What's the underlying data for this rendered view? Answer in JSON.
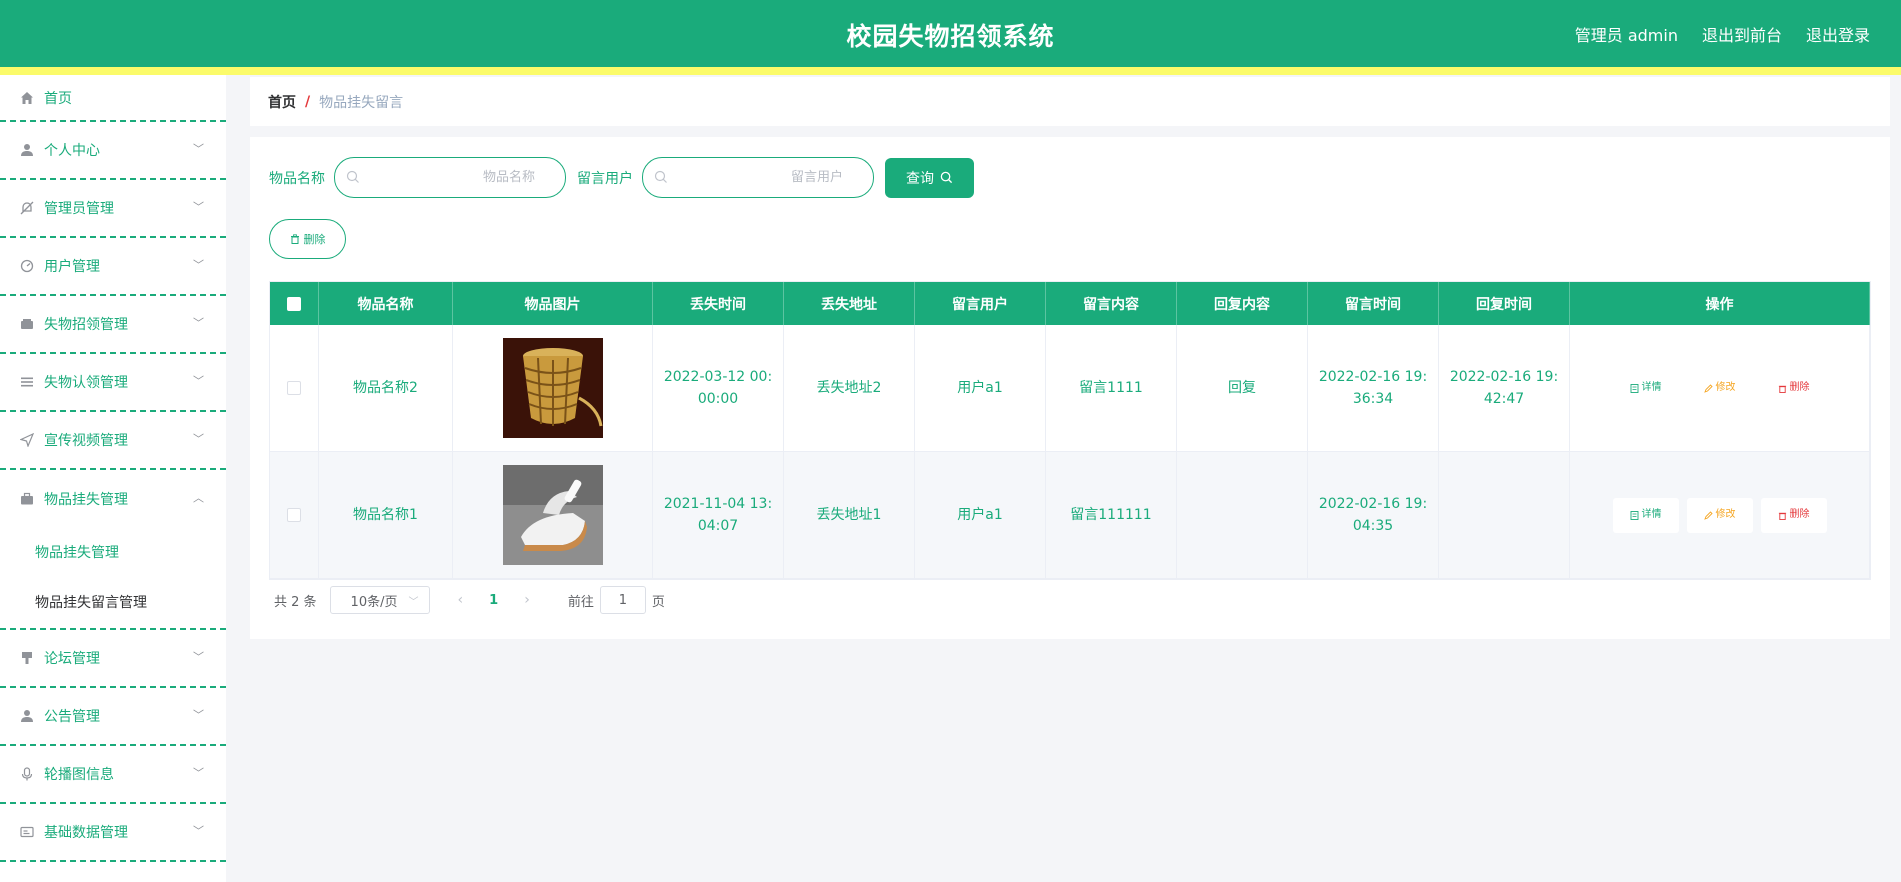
{
  "header": {
    "title": "校园失物招领系统",
    "admin_label": "管理员 admin",
    "to_front_label": "退出到前台",
    "logout_label": "退出登录"
  },
  "sidebar": {
    "items": [
      {
        "label": "首页",
        "icon": "home-icon"
      },
      {
        "label": "个人中心",
        "icon": "user-icon"
      },
      {
        "label": "管理员管理",
        "icon": "bell-off-icon"
      },
      {
        "label": "用户管理",
        "icon": "dashboard-icon"
      },
      {
        "label": "失物招领管理",
        "icon": "wallet-icon"
      },
      {
        "label": "失物认领管理",
        "icon": "list-icon"
      },
      {
        "label": "宣传视频管理",
        "icon": "send-icon"
      },
      {
        "label": "物品挂失管理",
        "icon": "briefcase-icon"
      },
      {
        "label": "论坛管理",
        "icon": "brush-icon"
      },
      {
        "label": "公告管理",
        "icon": "user-icon"
      },
      {
        "label": "轮播图信息",
        "icon": "microphone-icon"
      },
      {
        "label": "基础数据管理",
        "icon": "card-icon"
      }
    ],
    "submenu": [
      {
        "label": "物品挂失管理"
      },
      {
        "label": "物品挂失留言管理"
      }
    ]
  },
  "breadcrumb": {
    "home": "首页",
    "separator": "/",
    "current": "物品挂失留言"
  },
  "search": {
    "name_label": "物品名称",
    "name_placeholder": "物品名称",
    "user_label": "留言用户",
    "user_placeholder": "留言用户",
    "query_label": "查询"
  },
  "actions": {
    "delete_label": "删除"
  },
  "table": {
    "headers": [
      "物品名称",
      "物品图片",
      "丢失时间",
      "丢失地址",
      "留言用户",
      "留言内容",
      "回复内容",
      "留言时间",
      "回复时间",
      "操作"
    ],
    "rows": [
      {
        "name": "物品名称2",
        "lost_time": "2022-03-12 00:00:00",
        "lost_addr": "丢失地址2",
        "user": "用户a1",
        "content": "留言1111",
        "reply": "回复",
        "msg_time": "2022-02-16 19:36:34",
        "reply_time": "2022-02-16 19:42:47"
      },
      {
        "name": "物品名称1",
        "lost_time": "2021-11-04 13:04:07",
        "lost_addr": "丢失地址1",
        "user": "用户a1",
        "content": "留言111111",
        "reply": "",
        "msg_time": "2022-02-16 19:04:35",
        "reply_time": ""
      }
    ],
    "op_labels": {
      "detail": "详情",
      "edit": "修改",
      "delete": "删除"
    }
  },
  "pagination": {
    "total": "共 2 条",
    "page_size": "10条/页",
    "current_page": "1",
    "goto_prefix": "前往",
    "goto_value": "1",
    "goto_suffix": "页"
  },
  "colors": {
    "primary": "#1aab7b",
    "accent_strip": "#fbfb6a",
    "danger": "#e4393c",
    "warning": "#f5a623"
  }
}
